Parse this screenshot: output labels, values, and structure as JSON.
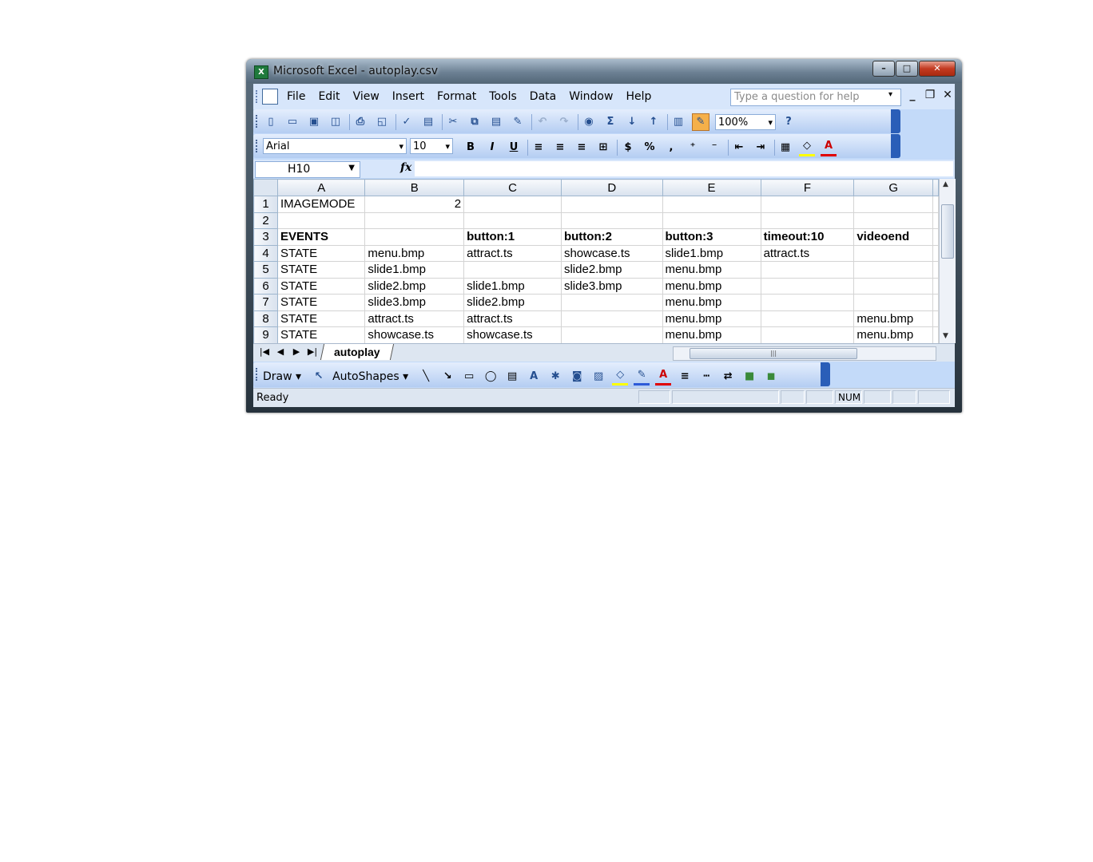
{
  "window": {
    "title": "Microsoft Excel - autoplay.csv"
  },
  "menu": {
    "items": [
      "File",
      "Edit",
      "View",
      "Insert",
      "Format",
      "Tools",
      "Data",
      "Window",
      "Help"
    ],
    "help_placeholder": "Type a question for help"
  },
  "toolbar": {
    "zoom": "100%"
  },
  "format_toolbar": {
    "font": "Arial",
    "size": "10"
  },
  "formula_bar": {
    "cell_ref": "H10",
    "fx": "fx",
    "value": ""
  },
  "grid": {
    "columns": [
      "A",
      "B",
      "C",
      "D",
      "E",
      "F",
      "G"
    ],
    "rows": [
      {
        "n": "1",
        "cells": [
          "IMAGEMODE",
          "2",
          "",
          "",
          "",
          "",
          ""
        ]
      },
      {
        "n": "2",
        "cells": [
          "",
          "",
          "",
          "",
          "",
          "",
          ""
        ]
      },
      {
        "n": "3",
        "cells": [
          "EVENTS",
          "",
          "button:1",
          "button:2",
          "button:3",
          "timeout:10",
          "videoend"
        ]
      },
      {
        "n": "4",
        "cells": [
          "STATE",
          "menu.bmp",
          "attract.ts",
          "showcase.ts",
          "slide1.bmp",
          "attract.ts",
          ""
        ]
      },
      {
        "n": "5",
        "cells": [
          "STATE",
          "slide1.bmp",
          "",
          "slide2.bmp",
          "menu.bmp",
          "",
          ""
        ]
      },
      {
        "n": "6",
        "cells": [
          "STATE",
          "slide2.bmp",
          "slide1.bmp",
          "slide3.bmp",
          "menu.bmp",
          "",
          ""
        ]
      },
      {
        "n": "7",
        "cells": [
          "STATE",
          "slide3.bmp",
          "slide2.bmp",
          "",
          "menu.bmp",
          "",
          ""
        ]
      },
      {
        "n": "8",
        "cells": [
          "STATE",
          "attract.ts",
          "attract.ts",
          "",
          "menu.bmp",
          "",
          "menu.bmp"
        ]
      },
      {
        "n": "9",
        "cells": [
          "STATE",
          "showcase.ts",
          "showcase.ts",
          "",
          "menu.bmp",
          "",
          "menu.bmp"
        ]
      }
    ]
  },
  "sheet": {
    "tab": "autoplay"
  },
  "drawing": {
    "draw_label": "Draw",
    "autoshapes_label": "AutoShapes"
  },
  "status": {
    "text": "Ready",
    "num": "NUM"
  }
}
